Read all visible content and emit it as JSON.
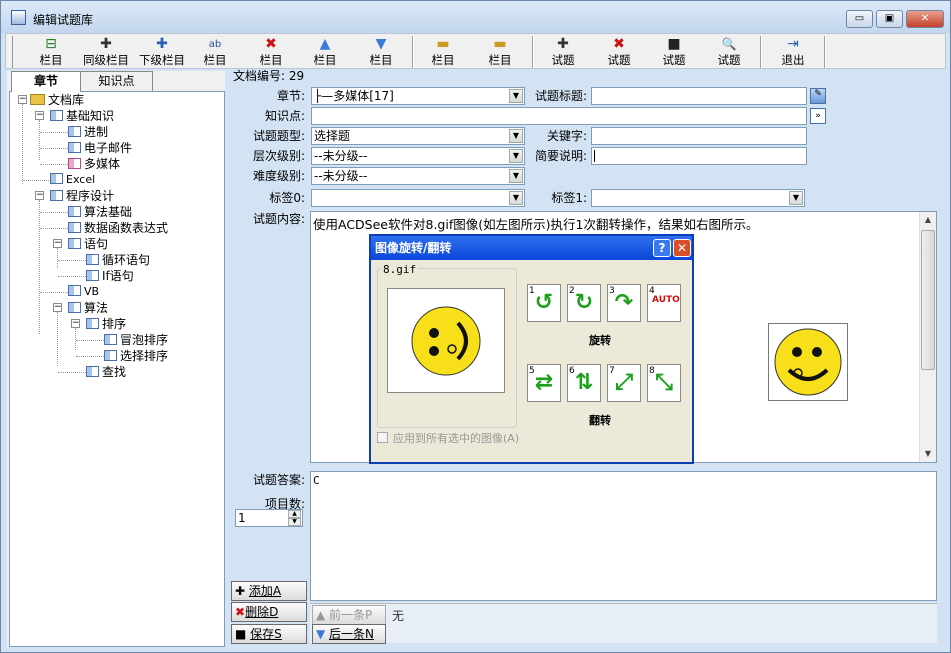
{
  "window": {
    "title": "编辑试题库",
    "min": "▭",
    "max": "▣",
    "close": "✕"
  },
  "toolbar": [
    {
      "icon": "⊟",
      "label": "栏目"
    },
    {
      "icon": "✚",
      "label": "同级栏目"
    },
    {
      "icon": "✚",
      "label": "下级栏目"
    },
    {
      "icon": "ab",
      "label": "栏目"
    },
    {
      "icon": "✖",
      "label": "栏目"
    },
    {
      "icon": "▲",
      "label": "栏目"
    },
    {
      "icon": "▼",
      "label": "栏目"
    },
    {
      "icon": "▬",
      "label": "栏目"
    },
    {
      "icon": "▬",
      "label": "栏目"
    },
    {
      "icon": "✚",
      "label": "试题"
    },
    {
      "icon": "✖",
      "label": "试题"
    },
    {
      "icon": "■",
      "label": "试题"
    },
    {
      "icon": "🔍",
      "label": "试题"
    },
    {
      "icon": "⇥",
      "label": "退出"
    }
  ],
  "tabs": {
    "chapter": "章节",
    "knowledge": "知识点"
  },
  "tree": {
    "root": "文档库",
    "n1": "基础知识",
    "n1a": "进制",
    "n1b": "电子邮件",
    "n1c": "多媒体",
    "n2": "Excel",
    "n3": "程序设计",
    "n3a": "算法基础",
    "n3b": "数据函数表达式",
    "n3c": "语句",
    "n3c1": "循环语句",
    "n3c2": "If语句",
    "n3d": "VB",
    "n3e": "算法",
    "n3e1": "排序",
    "n3e1a": "冒泡排序",
    "n3e1b": "选择排序",
    "n3e2": "查找"
  },
  "form": {
    "doc_no_label": "文档编号:",
    "doc_no": "29",
    "chapter_label": "章节:",
    "chapter_value": "├—多媒体[17]",
    "title_label": "试题标题:",
    "title_value": "",
    "knowledge_label": "知识点:",
    "knowledge_value": "",
    "type_label": "试题题型:",
    "type_value": "选择题",
    "keyword_label": "关键字:",
    "keyword_value": "",
    "level_label": "层次级别:",
    "level_value": "--未分级--",
    "brief_label": "简要说明:",
    "brief_value": "",
    "difficulty_label": "难度级别:",
    "difficulty_value": "--未分级--",
    "tag0_label": "标签0:",
    "tag0_value": "",
    "tag1_label": "标签1:",
    "tag1_value": "",
    "content_label": "试题内容:",
    "content_text": "使用ACDSee软件对8.gif图像(如左图所示)执行1次翻转操作，结果如右图所示。",
    "answer_label": "试题答案:",
    "answer_value": "C",
    "count_label": "项目数:",
    "count_value": "1"
  },
  "dialog": {
    "title": "图像旋转/翻转",
    "help": "?",
    "close": "✕",
    "file": "8.gif",
    "rotate_label": "旋转",
    "flip_label": "翻转",
    "apply_all": "应用到所有选中的图像(A)",
    "auto": "AUTO",
    "nums": [
      "1",
      "2",
      "3",
      "4",
      "5",
      "6",
      "7",
      "8"
    ]
  },
  "buttons": {
    "add": "添加A",
    "delete": "删除D",
    "save": "保存S",
    "prev": "前一条P",
    "next": "后一条N",
    "status": "无"
  },
  "colors": {
    "accent": "#0a46d8",
    "smiley": "#f7e01a",
    "arrow": "#1aa01a",
    "close_red": "#c4402a"
  }
}
